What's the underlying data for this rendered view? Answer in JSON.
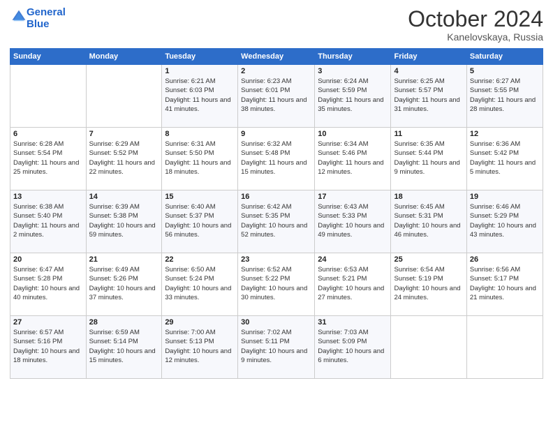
{
  "header": {
    "logo_line1": "General",
    "logo_line2": "Blue",
    "month": "October 2024",
    "location": "Kanelovskaya, Russia"
  },
  "weekdays": [
    "Sunday",
    "Monday",
    "Tuesday",
    "Wednesday",
    "Thursday",
    "Friday",
    "Saturday"
  ],
  "weeks": [
    [
      {
        "day": "",
        "info": ""
      },
      {
        "day": "",
        "info": ""
      },
      {
        "day": "1",
        "info": "Sunrise: 6:21 AM\nSunset: 6:03 PM\nDaylight: 11 hours and 41 minutes."
      },
      {
        "day": "2",
        "info": "Sunrise: 6:23 AM\nSunset: 6:01 PM\nDaylight: 11 hours and 38 minutes."
      },
      {
        "day": "3",
        "info": "Sunrise: 6:24 AM\nSunset: 5:59 PM\nDaylight: 11 hours and 35 minutes."
      },
      {
        "day": "4",
        "info": "Sunrise: 6:25 AM\nSunset: 5:57 PM\nDaylight: 11 hours and 31 minutes."
      },
      {
        "day": "5",
        "info": "Sunrise: 6:27 AM\nSunset: 5:55 PM\nDaylight: 11 hours and 28 minutes."
      }
    ],
    [
      {
        "day": "6",
        "info": "Sunrise: 6:28 AM\nSunset: 5:54 PM\nDaylight: 11 hours and 25 minutes."
      },
      {
        "day": "7",
        "info": "Sunrise: 6:29 AM\nSunset: 5:52 PM\nDaylight: 11 hours and 22 minutes."
      },
      {
        "day": "8",
        "info": "Sunrise: 6:31 AM\nSunset: 5:50 PM\nDaylight: 11 hours and 18 minutes."
      },
      {
        "day": "9",
        "info": "Sunrise: 6:32 AM\nSunset: 5:48 PM\nDaylight: 11 hours and 15 minutes."
      },
      {
        "day": "10",
        "info": "Sunrise: 6:34 AM\nSunset: 5:46 PM\nDaylight: 11 hours and 12 minutes."
      },
      {
        "day": "11",
        "info": "Sunrise: 6:35 AM\nSunset: 5:44 PM\nDaylight: 11 hours and 9 minutes."
      },
      {
        "day": "12",
        "info": "Sunrise: 6:36 AM\nSunset: 5:42 PM\nDaylight: 11 hours and 5 minutes."
      }
    ],
    [
      {
        "day": "13",
        "info": "Sunrise: 6:38 AM\nSunset: 5:40 PM\nDaylight: 11 hours and 2 minutes."
      },
      {
        "day": "14",
        "info": "Sunrise: 6:39 AM\nSunset: 5:38 PM\nDaylight: 10 hours and 59 minutes."
      },
      {
        "day": "15",
        "info": "Sunrise: 6:40 AM\nSunset: 5:37 PM\nDaylight: 10 hours and 56 minutes."
      },
      {
        "day": "16",
        "info": "Sunrise: 6:42 AM\nSunset: 5:35 PM\nDaylight: 10 hours and 52 minutes."
      },
      {
        "day": "17",
        "info": "Sunrise: 6:43 AM\nSunset: 5:33 PM\nDaylight: 10 hours and 49 minutes."
      },
      {
        "day": "18",
        "info": "Sunrise: 6:45 AM\nSunset: 5:31 PM\nDaylight: 10 hours and 46 minutes."
      },
      {
        "day": "19",
        "info": "Sunrise: 6:46 AM\nSunset: 5:29 PM\nDaylight: 10 hours and 43 minutes."
      }
    ],
    [
      {
        "day": "20",
        "info": "Sunrise: 6:47 AM\nSunset: 5:28 PM\nDaylight: 10 hours and 40 minutes."
      },
      {
        "day": "21",
        "info": "Sunrise: 6:49 AM\nSunset: 5:26 PM\nDaylight: 10 hours and 37 minutes."
      },
      {
        "day": "22",
        "info": "Sunrise: 6:50 AM\nSunset: 5:24 PM\nDaylight: 10 hours and 33 minutes."
      },
      {
        "day": "23",
        "info": "Sunrise: 6:52 AM\nSunset: 5:22 PM\nDaylight: 10 hours and 30 minutes."
      },
      {
        "day": "24",
        "info": "Sunrise: 6:53 AM\nSunset: 5:21 PM\nDaylight: 10 hours and 27 minutes."
      },
      {
        "day": "25",
        "info": "Sunrise: 6:54 AM\nSunset: 5:19 PM\nDaylight: 10 hours and 24 minutes."
      },
      {
        "day": "26",
        "info": "Sunrise: 6:56 AM\nSunset: 5:17 PM\nDaylight: 10 hours and 21 minutes."
      }
    ],
    [
      {
        "day": "27",
        "info": "Sunrise: 6:57 AM\nSunset: 5:16 PM\nDaylight: 10 hours and 18 minutes."
      },
      {
        "day": "28",
        "info": "Sunrise: 6:59 AM\nSunset: 5:14 PM\nDaylight: 10 hours and 15 minutes."
      },
      {
        "day": "29",
        "info": "Sunrise: 7:00 AM\nSunset: 5:13 PM\nDaylight: 10 hours and 12 minutes."
      },
      {
        "day": "30",
        "info": "Sunrise: 7:02 AM\nSunset: 5:11 PM\nDaylight: 10 hours and 9 minutes."
      },
      {
        "day": "31",
        "info": "Sunrise: 7:03 AM\nSunset: 5:09 PM\nDaylight: 10 hours and 6 minutes."
      },
      {
        "day": "",
        "info": ""
      },
      {
        "day": "",
        "info": ""
      }
    ]
  ]
}
